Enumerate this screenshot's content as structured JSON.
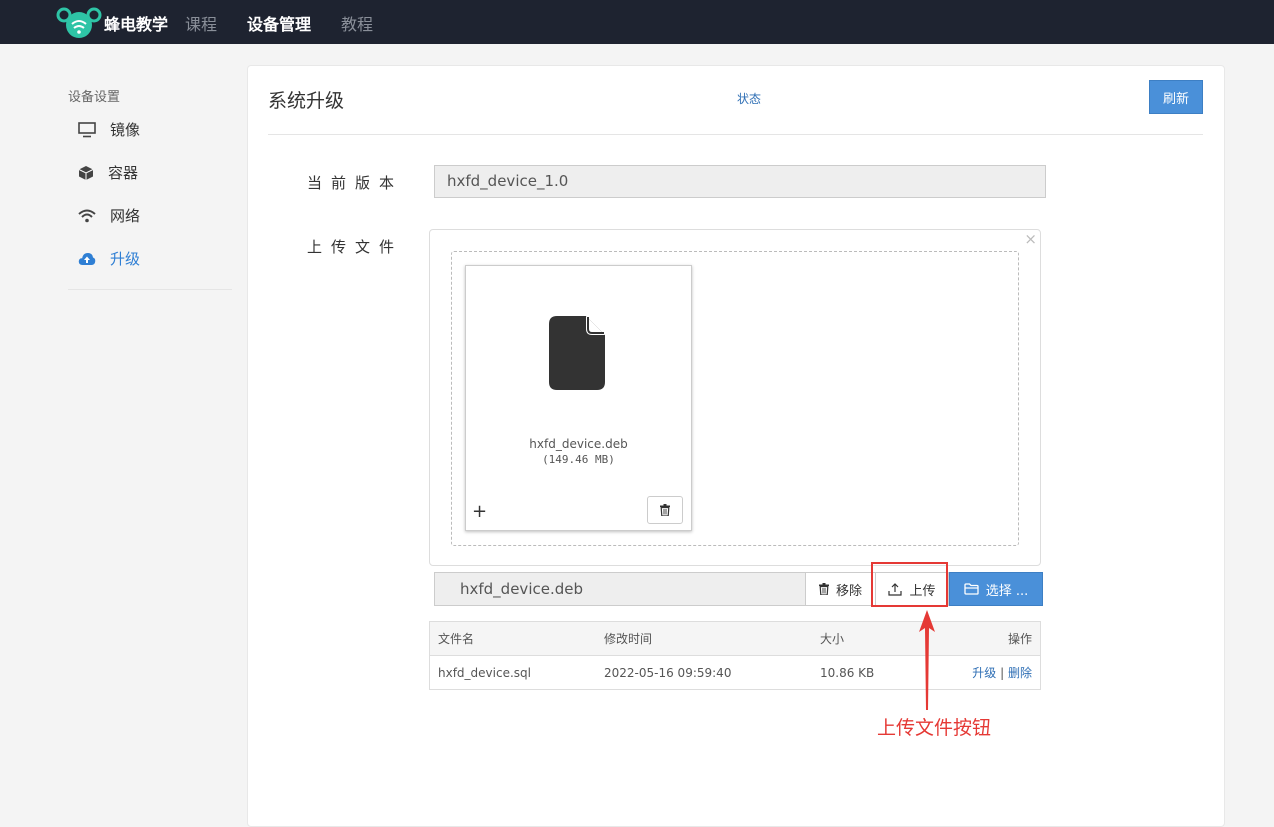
{
  "topbar": {
    "brand": "蜂电教学",
    "nav": [
      "课程",
      "设备管理",
      "教程"
    ],
    "active_nav": "设备管理"
  },
  "sidebar": {
    "heading": "设备设置",
    "items": [
      {
        "label": "镜像",
        "icon": "monitor-icon"
      },
      {
        "label": "容器",
        "icon": "cube-icon"
      },
      {
        "label": "网络",
        "icon": "wifi-icon"
      },
      {
        "label": "升级",
        "icon": "cloud-upload-icon",
        "active": true
      }
    ]
  },
  "panel": {
    "title": "系统升级",
    "status_link": "状态",
    "refresh_label": "刷新"
  },
  "form": {
    "version_label": "当前版本",
    "version_value": "hxfd_device_1.0",
    "upload_label": "上传文件"
  },
  "upload": {
    "close_symbol": "×",
    "preview_file_name": "hxfd_device.deb",
    "preview_file_size": "(149.46 MB)",
    "plus_symbol": "+",
    "caption_value": "hxfd_device.deb",
    "remove_label": "移除",
    "upload_label": "上传",
    "select_label": "选择 ..."
  },
  "table": {
    "headers": [
      "文件名",
      "修改时间",
      "大小",
      "操作"
    ],
    "rows": [
      {
        "name": "hxfd_device.sql",
        "modified": "2022-05-16 09:59:40",
        "size": "10.86 KB",
        "action_upgrade": "升级",
        "separator": "|",
        "action_delete": "删除"
      }
    ]
  },
  "annotation": {
    "text": "上传文件按钮",
    "color": "#e53935"
  },
  "colors": {
    "topbar_bg": "#1e2330",
    "primary": "#4a90d9",
    "link": "#2f6fb5",
    "active_sidebar": "#2f7fd4"
  }
}
